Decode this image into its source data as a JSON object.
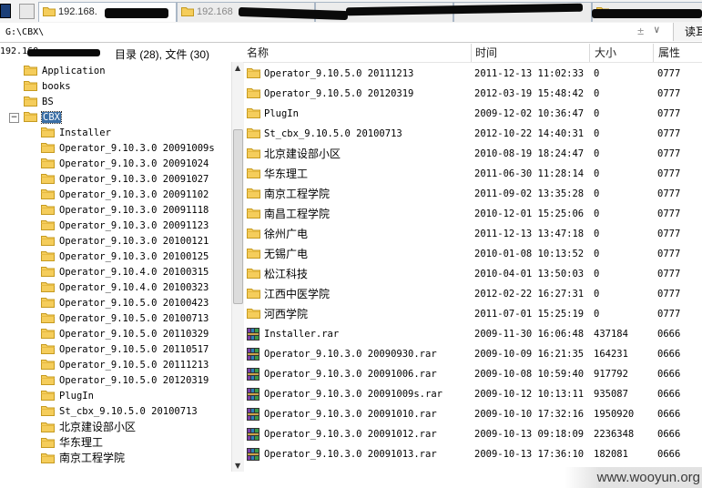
{
  "tabs": [
    {
      "label": "192.168."
    },
    {
      "label": "192.168"
    }
  ],
  "address": {
    "value": "G:\\CBX\\"
  },
  "toolbar": {
    "read_label": "读耳"
  },
  "tree_panel": {
    "header_prefix": "192.168",
    "summary": "目录 (28), 文件 (30)",
    "items": [
      {
        "label": "Application",
        "level": 0,
        "selected": false,
        "expander": ""
      },
      {
        "label": "books",
        "level": 0,
        "selected": false,
        "expander": ""
      },
      {
        "label": "BS",
        "level": 0,
        "selected": false,
        "expander": ""
      },
      {
        "label": "CBX",
        "level": 0,
        "selected": true,
        "expander": "−"
      },
      {
        "label": "Installer",
        "level": 1,
        "selected": false,
        "expander": ""
      },
      {
        "label": "Operator_9.10.3.0 20091009s",
        "level": 1,
        "selected": false,
        "expander": ""
      },
      {
        "label": "Operator_9.10.3.0 20091024",
        "level": 1,
        "selected": false,
        "expander": ""
      },
      {
        "label": "Operator_9.10.3.0 20091027",
        "level": 1,
        "selected": false,
        "expander": ""
      },
      {
        "label": "Operator_9.10.3.0 20091102",
        "level": 1,
        "selected": false,
        "expander": ""
      },
      {
        "label": "Operator_9.10.3.0 20091118",
        "level": 1,
        "selected": false,
        "expander": ""
      },
      {
        "label": "Operator_9.10.3.0 20091123",
        "level": 1,
        "selected": false,
        "expander": ""
      },
      {
        "label": "Operator_9.10.3.0 20100121",
        "level": 1,
        "selected": false,
        "expander": ""
      },
      {
        "label": "Operator_9.10.3.0 20100125",
        "level": 1,
        "selected": false,
        "expander": ""
      },
      {
        "label": "Operator_9.10.4.0 20100315",
        "level": 1,
        "selected": false,
        "expander": ""
      },
      {
        "label": "Operator_9.10.4.0 20100323",
        "level": 1,
        "selected": false,
        "expander": ""
      },
      {
        "label": "Operator_9.10.5.0 20100423",
        "level": 1,
        "selected": false,
        "expander": ""
      },
      {
        "label": "Operator_9.10.5.0 20100713",
        "level": 1,
        "selected": false,
        "expander": ""
      },
      {
        "label": "Operator_9.10.5.0 20110329",
        "level": 1,
        "selected": false,
        "expander": ""
      },
      {
        "label": "Operator_9.10.5.0 20110517",
        "level": 1,
        "selected": false,
        "expander": ""
      },
      {
        "label": "Operator_9.10.5.0 20111213",
        "level": 1,
        "selected": false,
        "expander": ""
      },
      {
        "label": "Operator_9.10.5.0 20120319",
        "level": 1,
        "selected": false,
        "expander": ""
      },
      {
        "label": "PlugIn",
        "level": 1,
        "selected": false,
        "expander": ""
      },
      {
        "label": "St_cbx_9.10.5.0 20100713",
        "level": 1,
        "selected": false,
        "expander": ""
      },
      {
        "label": "北京建设部小区",
        "level": 1,
        "selected": false,
        "expander": ""
      },
      {
        "label": "华东理工",
        "level": 1,
        "selected": false,
        "expander": ""
      },
      {
        "label": "南京工程学院",
        "level": 1,
        "selected": false,
        "expander": ""
      }
    ]
  },
  "file_list": {
    "columns": {
      "name": "名称",
      "time": "时间",
      "size": "大小",
      "attr": "属性"
    },
    "rows": [
      {
        "name": "Operator_9.10.5.0 20111213",
        "time": "2011-12-13 11:02:33",
        "size": "0",
        "attr": "0777",
        "kind": "folder"
      },
      {
        "name": "Operator_9.10.5.0 20120319",
        "time": "2012-03-19 15:48:42",
        "size": "0",
        "attr": "0777",
        "kind": "folder"
      },
      {
        "name": "PlugIn",
        "time": "2009-12-02 10:36:47",
        "size": "0",
        "attr": "0777",
        "kind": "folder"
      },
      {
        "name": "St_cbx_9.10.5.0 20100713",
        "time": "2012-10-22 14:40:31",
        "size": "0",
        "attr": "0777",
        "kind": "folder"
      },
      {
        "name": "北京建设部小区",
        "time": "2010-08-19 18:24:47",
        "size": "0",
        "attr": "0777",
        "kind": "folder"
      },
      {
        "name": "华东理工",
        "time": "2011-06-30 11:28:14",
        "size": "0",
        "attr": "0777",
        "kind": "folder"
      },
      {
        "name": "南京工程学院",
        "time": "2011-09-02 13:35:28",
        "size": "0",
        "attr": "0777",
        "kind": "folder"
      },
      {
        "name": "南昌工程学院",
        "time": "2010-12-01 15:25:06",
        "size": "0",
        "attr": "0777",
        "kind": "folder"
      },
      {
        "name": "徐州广电",
        "time": "2011-12-13 13:47:18",
        "size": "0",
        "attr": "0777",
        "kind": "folder"
      },
      {
        "name": "无锡广电",
        "time": "2010-01-08 10:13:52",
        "size": "0",
        "attr": "0777",
        "kind": "folder"
      },
      {
        "name": "松江科技",
        "time": "2010-04-01 13:50:03",
        "size": "0",
        "attr": "0777",
        "kind": "folder"
      },
      {
        "name": "江西中医学院",
        "time": "2012-02-22 16:27:31",
        "size": "0",
        "attr": "0777",
        "kind": "folder"
      },
      {
        "name": "河西学院",
        "time": "2011-07-01 15:25:19",
        "size": "0",
        "attr": "0777",
        "kind": "folder"
      },
      {
        "name": "Installer.rar",
        "time": "2009-11-30 16:06:48",
        "size": "437184",
        "attr": "0666",
        "kind": "rar"
      },
      {
        "name": "Operator_9.10.3.0 20090930.rar",
        "time": "2009-10-09 16:21:35",
        "size": "164231",
        "attr": "0666",
        "kind": "rar"
      },
      {
        "name": "Operator_9.10.3.0 20091006.rar",
        "time": "2009-10-08 10:59:40",
        "size": "917792",
        "attr": "0666",
        "kind": "rar"
      },
      {
        "name": "Operator_9.10.3.0 20091009s.rar",
        "time": "2009-10-12 10:13:11",
        "size": "935087",
        "attr": "0666",
        "kind": "rar"
      },
      {
        "name": "Operator_9.10.3.0 20091010.rar",
        "time": "2009-10-10 17:32:16",
        "size": "1950920",
        "attr": "0666",
        "kind": "rar"
      },
      {
        "name": "Operator_9.10.3.0 20091012.rar",
        "time": "2009-10-13 09:18:09",
        "size": "2236348",
        "attr": "0666",
        "kind": "rar"
      },
      {
        "name": "Operator_9.10.3.0 20091013.rar",
        "time": "2009-10-13 17:36:10",
        "size": "182081",
        "attr": "0666",
        "kind": "rar"
      }
    ]
  },
  "watermark": "www.wooyun.org",
  "colors": {
    "folder": "#f5cd5b",
    "folder_edge": "#c59a1f",
    "selection": "#3a6ea5"
  },
  "icons": {
    "folder": "folder-icon",
    "rar": "rar-archive-icon"
  }
}
